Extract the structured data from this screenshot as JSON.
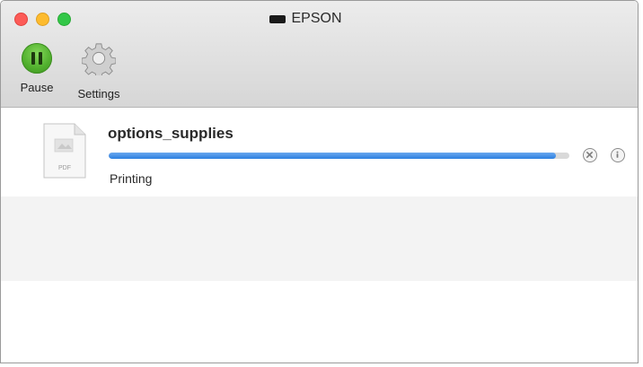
{
  "window": {
    "title": "EPSON"
  },
  "toolbar": {
    "pause_label": "Pause",
    "settings_label": "Settings"
  },
  "jobs": [
    {
      "name": "options_supplies",
      "status": "Printing",
      "progress": 0.97,
      "file_type_label": "PDF"
    }
  ],
  "colors": {
    "progress": "#2c7fe0",
    "pause_button": "#4fae2c",
    "traffic_close": "#fc5b57",
    "traffic_minimize": "#fdbb2e",
    "traffic_zoom": "#33c748"
  },
  "icons": {
    "pause": "pause-icon",
    "settings": "gear-icon",
    "document": "pdf-document-icon",
    "cancel": "cancel-icon",
    "info": "info-icon"
  }
}
